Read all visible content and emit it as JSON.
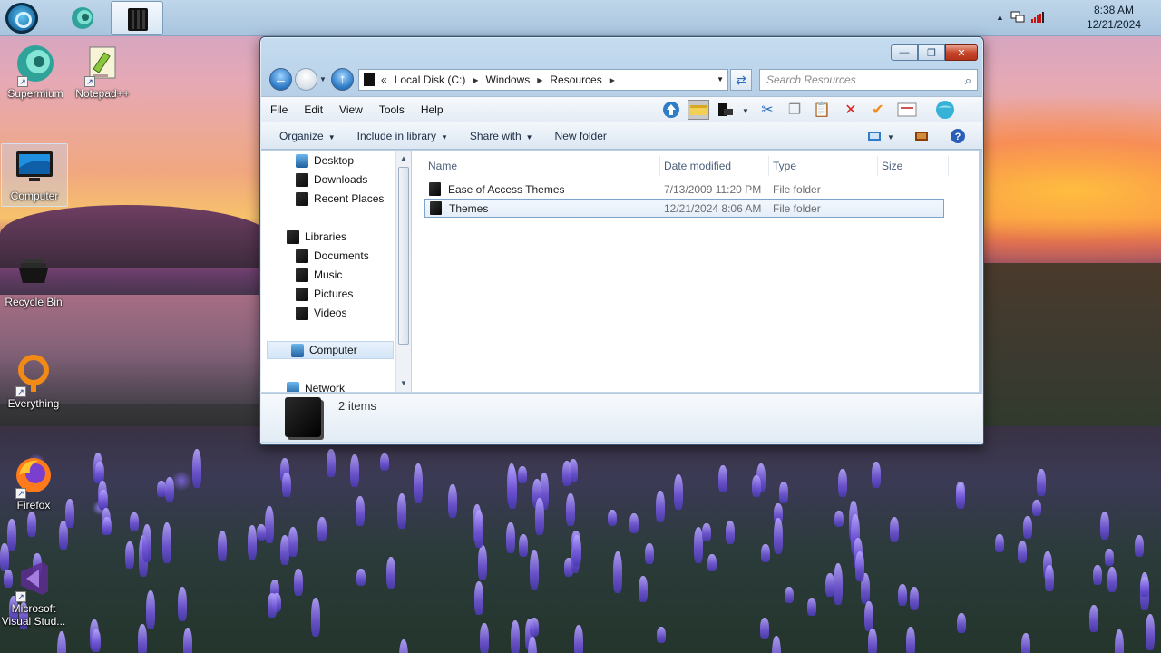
{
  "taskbar": {
    "time": "8:38 AM",
    "date": "12/21/2024",
    "tray_arrow": "▲"
  },
  "desktop_icons": [
    {
      "label": "Supermium",
      "icon": "supermium-icon"
    },
    {
      "label": "Notepad++",
      "icon": "notepadpp-icon"
    },
    {
      "label": "Computer",
      "icon": "computer-icon"
    },
    {
      "label": "Recycle Bin",
      "icon": "recycle-bin-icon"
    },
    {
      "label": "Everything",
      "icon": "everything-icon"
    },
    {
      "label": "Firefox",
      "icon": "firefox-icon"
    },
    {
      "label": "Microsoft Visual Stud...",
      "icon": "visual-studio-icon"
    }
  ],
  "explorer": {
    "address": {
      "prefix": "«",
      "crumbs": [
        "Local Disk (C:)",
        "Windows",
        "Resources"
      ]
    },
    "search_placeholder": "Search Resources",
    "menu": [
      "File",
      "Edit",
      "View",
      "Tools",
      "Help"
    ],
    "commands": {
      "organize": "Organize",
      "include": "Include in library",
      "share": "Share with",
      "new_folder": "New folder"
    },
    "nav": {
      "desktop": "Desktop",
      "downloads": "Downloads",
      "recent": "Recent Places",
      "libraries": "Libraries",
      "documents": "Documents",
      "music": "Music",
      "pictures": "Pictures",
      "videos": "Videos",
      "computer": "Computer",
      "network": "Network"
    },
    "columns": {
      "name": "Name",
      "date": "Date modified",
      "type": "Type",
      "size": "Size"
    },
    "files": [
      {
        "name": "Ease of Access Themes",
        "date": "7/13/2009 11:20 PM",
        "type": "File folder"
      },
      {
        "name": "Themes",
        "date": "12/21/2024 8:06 AM",
        "type": "File folder"
      }
    ],
    "status": "2 items"
  },
  "colors": {
    "accent": "#2f7cc7",
    "close": "#c6472c"
  }
}
